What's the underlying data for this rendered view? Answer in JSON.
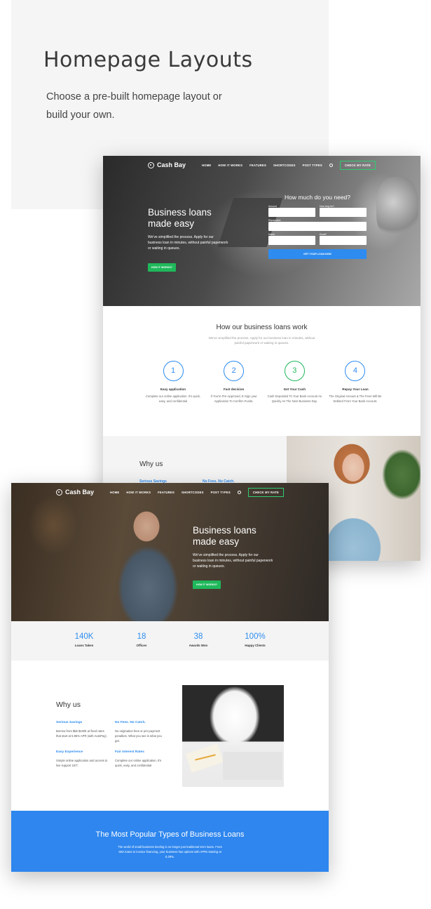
{
  "intro": {
    "title": "Homepage Layouts",
    "description": "Choose a pre-built homepage layout or build your own."
  },
  "nav": {
    "brand": "Cash Bay",
    "items": [
      "HOME",
      "HOW IT WORKS",
      "FEATURES",
      "SHORTCODES",
      "POST TYPES"
    ],
    "cta": "CHECK MY RATE"
  },
  "hero": {
    "headline": "Business loans made easy",
    "subtext": "We've simplified the process. Apply for our business loan in minutes, without painful paperwork or waiting in queues.",
    "button": "HOW IT WORKS?"
  },
  "loan_form": {
    "title": "How much do you need?",
    "amount_label": "Amount",
    "term_label": "How long for?",
    "repayment_label": "Repayment",
    "name_label": "Name",
    "email_label": "Email*",
    "submit": "GET YOUR LOAN NOW"
  },
  "how": {
    "title": "How our business loans work",
    "subtitle": "We've simplified the process. Apply for our business loan in minutes, without painful paperwork or waiting in queues.",
    "steps": [
      {
        "num": "1",
        "title": "Easy application",
        "desc": "Complete our online application. It's quick, easy, and confidential"
      },
      {
        "num": "2",
        "title": "Fast decision",
        "desc": "If You're Pre-Approved, E-Sign your Application To Confirm Funds."
      },
      {
        "num": "3",
        "title": "Get Your Cash",
        "desc": "Cash Deposited To Your Bank Account As Quickly As The Next Business Day."
      },
      {
        "num": "4",
        "title": "Repay Your Loan",
        "desc": "The Original Amount & The Fees Will Be Debited From Your Bank Account."
      }
    ]
  },
  "why": {
    "title": "Why us",
    "features": [
      {
        "title": "Serious Savings",
        "desc": "Borrow from $5k-$100k at fixed rates that start at 5.95% APR (with AutoPay)."
      },
      {
        "title": "No Fees. No Catch.",
        "desc": "No origination fees or pre-payment penalties. What you see is what you get."
      },
      {
        "title": "Easy Experience",
        "desc": "Simple online application and access to live support 24/7."
      },
      {
        "title": "Fair Interest Rates",
        "desc": "Complete our online application. It's quick, easy, and confidential"
      }
    ]
  },
  "stats": [
    {
      "value": "140K",
      "label": "Loans Taken"
    },
    {
      "value": "18",
      "label": "Offices"
    },
    {
      "value": "38",
      "label": "Awards Won"
    },
    {
      "value": "100%",
      "label": "Happy Clients"
    }
  ],
  "popular": {
    "title": "The Most Popular Types of Business Loans",
    "desc": "The world of small business lending is no longer just traditional term loans. From SBA loans to invoice financing, your business has options with APRs starting at 6.29%."
  },
  "colors": {
    "accent_blue": "#2e8cf0",
    "accent_green": "#1fb85b",
    "band_blue": "#2e86ee"
  }
}
